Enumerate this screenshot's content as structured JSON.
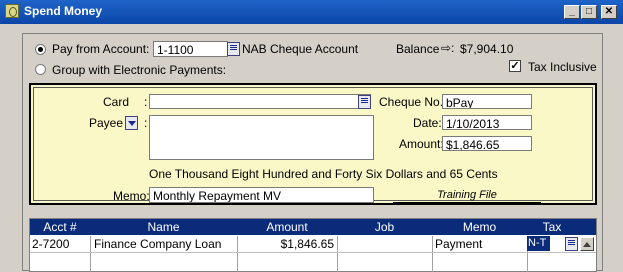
{
  "window": {
    "title": "Spend Money",
    "controls": [
      "_",
      "□",
      "✕"
    ]
  },
  "top": {
    "pay_from_label": "Pay from Account:",
    "account_number": "1-1100",
    "account_name": "NAB Cheque Account",
    "balance_label": "Balance",
    "balance_value": "$7,904.10",
    "group_label": "Group with Electronic Payments:",
    "tax_inclusive_label": "Tax Inclusive",
    "tax_inclusive_checked": true
  },
  "cheque": {
    "card_label": "Card",
    "card_value": "",
    "payee_label": "Payee",
    "payee_value": "",
    "cheque_no_label": "Cheque No.:",
    "cheque_no_value": "bPay",
    "date_label": "Date:",
    "date_value": "1/10/2013",
    "amount_label": "Amount:",
    "amount_value": "$1,846.65",
    "amount_words": "One Thousand Eight Hundred and Forty Six Dollars and 65 Cents",
    "memo_label": "Memo:",
    "memo_value": "Monthly Repayment MV",
    "training_label": "Training File",
    "colon": ":"
  },
  "grid": {
    "headers": [
      "Acct #",
      "Name",
      "Amount",
      "Job",
      "Memo",
      "Tax"
    ],
    "rows": [
      {
        "acct": "2-7200",
        "name": "Finance Company Loan",
        "amount": "$1,846.65",
        "job": "",
        "memo": "Payment",
        "tax": "N-T"
      }
    ]
  },
  "colors": {
    "title_bar": "#0b45a8",
    "cheque_bg": "#fbf8c8",
    "grid_header": "#0a2a7a"
  }
}
